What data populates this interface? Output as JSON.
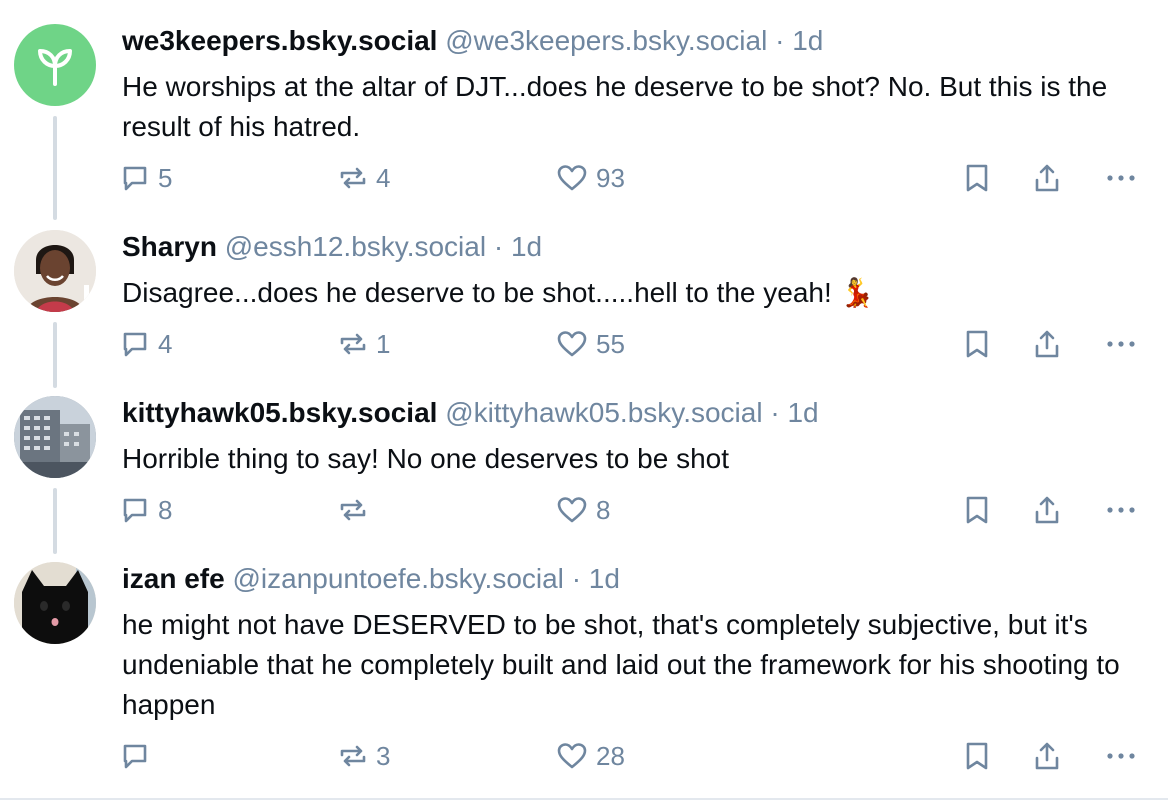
{
  "posts": [
    {
      "display_name": "we3keepers.bsky.social",
      "handle": "@we3keepers.bsky.social",
      "separator": "·",
      "time": "1d",
      "text": "He worships at the altar of DJT...does he deserve to be shot? No. But this is the result of his hatred.",
      "reply_count": "5",
      "repost_count": "4",
      "like_count": "93",
      "avatar": "sprout-icon",
      "avatar_color": "#6fd487"
    },
    {
      "display_name": "Sharyn",
      "handle": "@essh12.bsky.social",
      "separator": "·",
      "time": "1d",
      "text": "Disagree...does he deserve to be shot.....hell to the yeah! 💃",
      "reply_count": "4",
      "repost_count": "1",
      "like_count": "55",
      "avatar": "person-photo"
    },
    {
      "display_name": "kittyhawk05.bsky.social",
      "handle": "@kittyhawk05.bsky.social",
      "separator": "·",
      "time": "1d",
      "text": "Horrible thing to say! No one deserves to be shot",
      "reply_count": "8",
      "repost_count": "",
      "like_count": "8",
      "avatar": "building-photo"
    },
    {
      "display_name": "izan efe",
      "handle": "@izanpuntoefe.bsky.social",
      "separator": "·",
      "time": "1d",
      "text": "he might not have DESERVED to be shot, that's completely subjective, but it's undeniable that he completely built and laid out the framework for his shooting to happen",
      "reply_count": "",
      "repost_count": "3",
      "like_count": "28",
      "avatar": "black-cat-photo"
    }
  ],
  "icons": {
    "reply": "reply-icon",
    "repost": "repost-icon",
    "like": "heart-icon",
    "bookmark": "bookmark-icon",
    "share": "share-icon",
    "more": "more-options-icon"
  },
  "colors": {
    "text": "#0b0f14",
    "muted": "#6f869f",
    "thread_line": "#d4dbe2"
  }
}
